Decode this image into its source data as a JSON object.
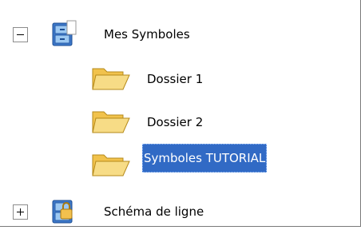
{
  "tree": {
    "items": [
      {
        "label": "Mes Symboles",
        "icon": "cabinet-icon",
        "expander": "collapse"
      },
      {
        "label": "Dossier 1",
        "icon": "folder-open-icon"
      },
      {
        "label": "Dossier 2",
        "icon": "folder-open-icon"
      },
      {
        "label": "Symboles TUTORIAL",
        "icon": "folder-open-icon",
        "selected": true
      },
      {
        "label": "Schéma de ligne",
        "icon": "locked-cabinet-icon",
        "expander": "expand"
      }
    ]
  },
  "colors": {
    "selection": "#316ac5",
    "folder": "#f5d36b"
  }
}
